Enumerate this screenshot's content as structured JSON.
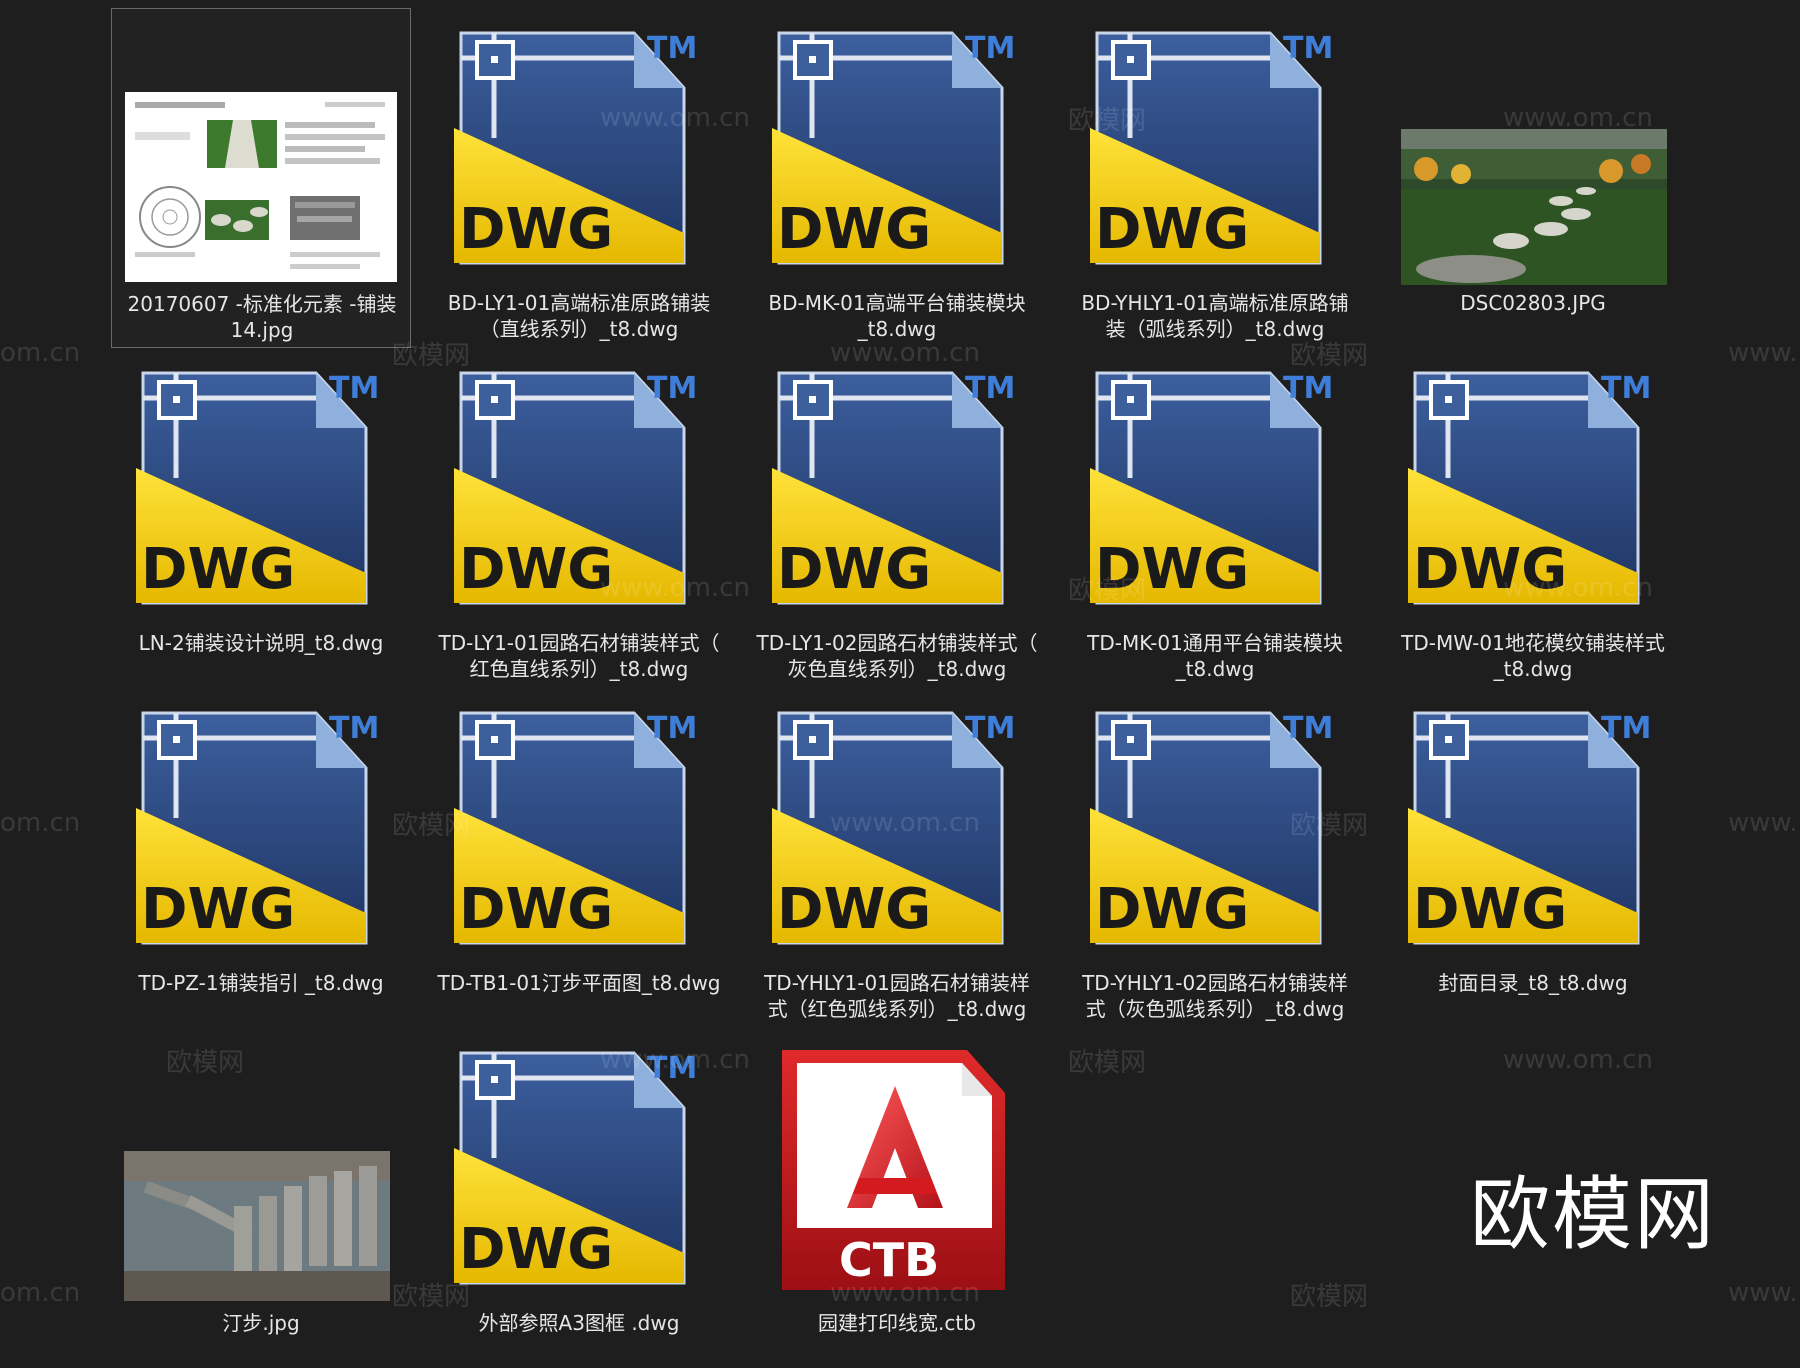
{
  "files": [
    {
      "name": "20170607 -标准化元素 -铺装14.jpg",
      "type": "jpg-doc",
      "selected": true
    },
    {
      "name": "BD-LY1-01高端标准原路铺装（直线系列）_t8.dwg",
      "type": "dwg"
    },
    {
      "name": "BD-MK-01高端平台铺装模块_t8.dwg",
      "type": "dwg"
    },
    {
      "name": "BD-YHLY1-01高端标准原路铺装（弧线系列）_t8.dwg",
      "type": "dwg"
    },
    {
      "name": "DSC02803.JPG",
      "type": "jpg-garden"
    },
    {
      "name": "LN-2铺装设计说明_t8.dwg",
      "type": "dwg"
    },
    {
      "name": "TD-LY1-01园路石材铺装样式（红色直线系列）_t8.dwg",
      "type": "dwg"
    },
    {
      "name": "TD-LY1-02园路石材铺装样式（灰色直线系列）_t8.dwg",
      "type": "dwg"
    },
    {
      "name": "TD-MK-01通用平台铺装模块_t8.dwg",
      "type": "dwg"
    },
    {
      "name": "TD-MW-01地花模纹铺装样式_t8.dwg",
      "type": "dwg"
    },
    {
      "name": "TD-PZ-1铺装指引 _t8.dwg",
      "type": "dwg"
    },
    {
      "name": "TD-TB1-01汀步平面图_t8.dwg",
      "type": "dwg"
    },
    {
      "name": "TD-YHLY1-01园路石材铺装样式（红色弧线系列）_t8.dwg",
      "type": "dwg"
    },
    {
      "name": "TD-YHLY1-02园路石材铺装样式（灰色弧线系列）_t8.dwg",
      "type": "dwg"
    },
    {
      "name": "封面目录_t8_t8.dwg",
      "type": "dwg"
    },
    {
      "name": "汀步.jpg",
      "type": "jpg-steps"
    },
    {
      "name": "外部参照A3图框 .dwg",
      "type": "dwg"
    },
    {
      "name": "园建打印线宽.ctb",
      "type": "ctb"
    }
  ],
  "labels": [
    "20170607 -标准化元素 -铺装\n14.jpg",
    "BD-LY1-01高端标准原路铺装\n（直线系列）_t8.dwg",
    "BD-MK-01高端平台铺装模块\n_t8.dwg",
    "BD-YHLY1-01高端标准原路铺\n装（弧线系列）_t8.dwg",
    "DSC02803.JPG",
    "LN-2铺装设计说明_t8.dwg",
    "TD-LY1-01园路石材铺装样式（\n红色直线系列）_t8.dwg",
    "TD-LY1-02园路石材铺装样式（\n灰色直线系列）_t8.dwg",
    "TD-MK-01通用平台铺装模块\n_t8.dwg",
    "TD-MW-01地花模纹铺装样式\n_t8.dwg",
    "TD-PZ-1铺装指引 _t8.dwg",
    "TD-TB1-01汀步平面图_t8.dwg",
    "TD-YHLY1-01园路石材铺装样\n式（红色弧线系列）_t8.dwg",
    "TD-YHLY1-02园路石材铺装样\n式（灰色弧线系列）_t8.dwg",
    "封面目录_t8_t8.dwg",
    "汀步.jpg",
    "外部参照A3图框 .dwg",
    "园建打印线宽.ctb"
  ],
  "icon_text": {
    "dwg": "DWG",
    "tm": "TM",
    "ctb": "CTB"
  },
  "watermarks": {
    "site": "www.om.cn",
    "cn": "欧模网",
    "partial_left": "om.cn",
    "partial_right": "www."
  },
  "brand": "欧模网",
  "colors": {
    "background": "#1e1e1e",
    "dwg_blue": "#2f4f86",
    "dwg_yellow": "#f2c900",
    "tm_blue": "#3f7ed8",
    "ctb_red": "#c8181e"
  }
}
